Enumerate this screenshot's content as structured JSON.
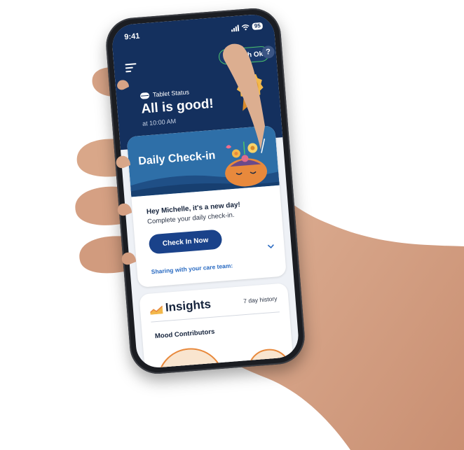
{
  "status_bar": {
    "time": "9:41",
    "battery": "95"
  },
  "header": {
    "patch_status": "Patch Ok",
    "help_label": "?",
    "tablet_status_label": "Tablet Status",
    "status_title": "All is good!",
    "status_time": "at 10:00 AM"
  },
  "checkin": {
    "banner_title": "Daily Check-in",
    "greeting": "Hey Michelle, it's a new day!",
    "subtext": "Complete your daily check-in.",
    "button_label": "Check In Now",
    "sharing_label": "Sharing with your care team:"
  },
  "insights": {
    "title": "Insights",
    "history_label": "7 day history",
    "section_label": "Mood Contributors"
  },
  "colors": {
    "header_bg": "#14305e",
    "patch_ok": "#4cc46a",
    "primary_button": "#1a428a",
    "banner_bg": "#2e6fa8",
    "link": "#2a6bc2",
    "accent_orange": "#e8893c"
  },
  "icons": {
    "menu": "menu-icon",
    "patch_dot": "status-dot-icon",
    "help": "help-icon",
    "tablet": "pill-icon",
    "badge": "award-badge-icon",
    "chevron": "chevron-down-icon",
    "insights": "trend-icon"
  }
}
